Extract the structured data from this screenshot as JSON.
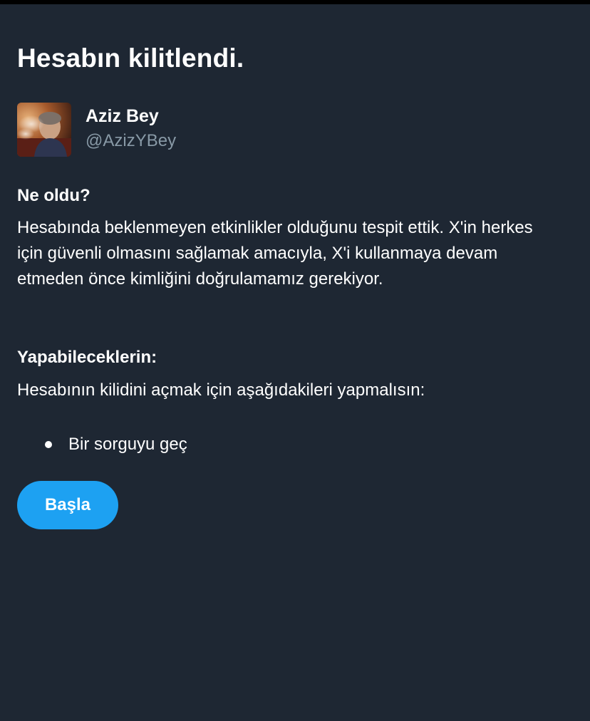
{
  "page": {
    "title": "Hesabın kilitlendi."
  },
  "account": {
    "display_name": "Aziz Bey",
    "handle": "@AzizYBey",
    "avatar_icon": "user-photo"
  },
  "what_happened": {
    "heading": "Ne oldu?",
    "text": "Hesabında beklenmeyen etkinlikler olduğunu tespit ettik. X'in herkes için güvenli olmasını sağlamak amacıyla, X'i kullanmaya devam etmeden önce kimliğini doğrulamamız gerekiyor."
  },
  "what_you_can_do": {
    "heading": "Yapabileceklerin:",
    "text": "Hesabının kilidini açmak için aşağıdakileri yapmalısın:",
    "items": [
      "Bir sorguyu geç"
    ]
  },
  "actions": {
    "start_label": "Başla"
  },
  "colors": {
    "background": "#1e2733",
    "text": "#ffffff",
    "muted_text": "#8899a6",
    "accent": "#1da1f2"
  }
}
